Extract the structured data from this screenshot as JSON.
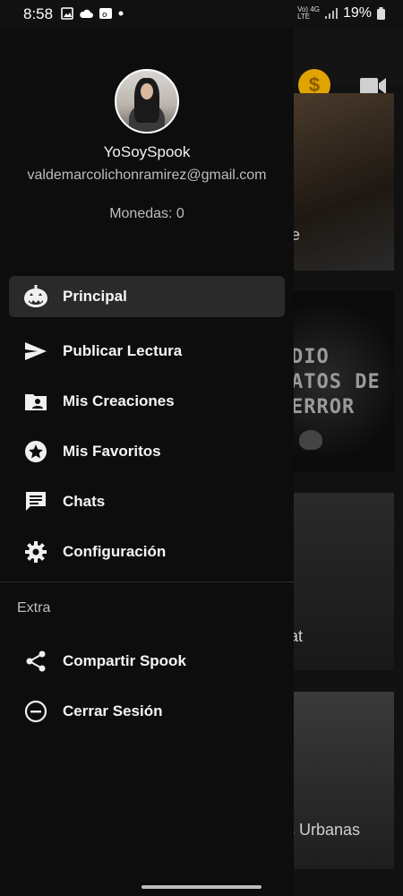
{
  "status_bar": {
    "time": "8:58",
    "network_top": "Vo) 4G",
    "network_bottom": "LTE",
    "battery": "19%"
  },
  "background": {
    "card_texts": [
      "e",
      "at",
      "s Urbanas"
    ],
    "horror_lines": [
      "DIO",
      "ATOS DE",
      "ERROR"
    ]
  },
  "drawer": {
    "profile": {
      "username": "YoSoySpook",
      "email": "valdemarcolichonramirez@gmail.com",
      "coins": "Monedas: 0"
    },
    "menu": [
      {
        "label": "Principal",
        "icon": "pumpkin-icon",
        "active": true
      },
      {
        "label": "Publicar Lectura",
        "icon": "send-icon",
        "active": false
      },
      {
        "label": "Mis Creaciones",
        "icon": "folder-user-icon",
        "active": false
      },
      {
        "label": "Mis Favoritos",
        "icon": "star-icon",
        "active": false
      },
      {
        "label": "Chats",
        "icon": "chat-icon",
        "active": false
      },
      {
        "label": "Configuración",
        "icon": "gear-icon",
        "active": false
      }
    ],
    "extra_section_label": "Extra",
    "extra_menu": [
      {
        "label": "Compartir Spook",
        "icon": "share-icon"
      },
      {
        "label": "Cerrar Sesión",
        "icon": "logout-icon"
      }
    ]
  },
  "colors": {
    "drawer_bg": "#0d0d0d",
    "active_item_bg": "#2a2a2a",
    "coin": "#e0a400"
  }
}
